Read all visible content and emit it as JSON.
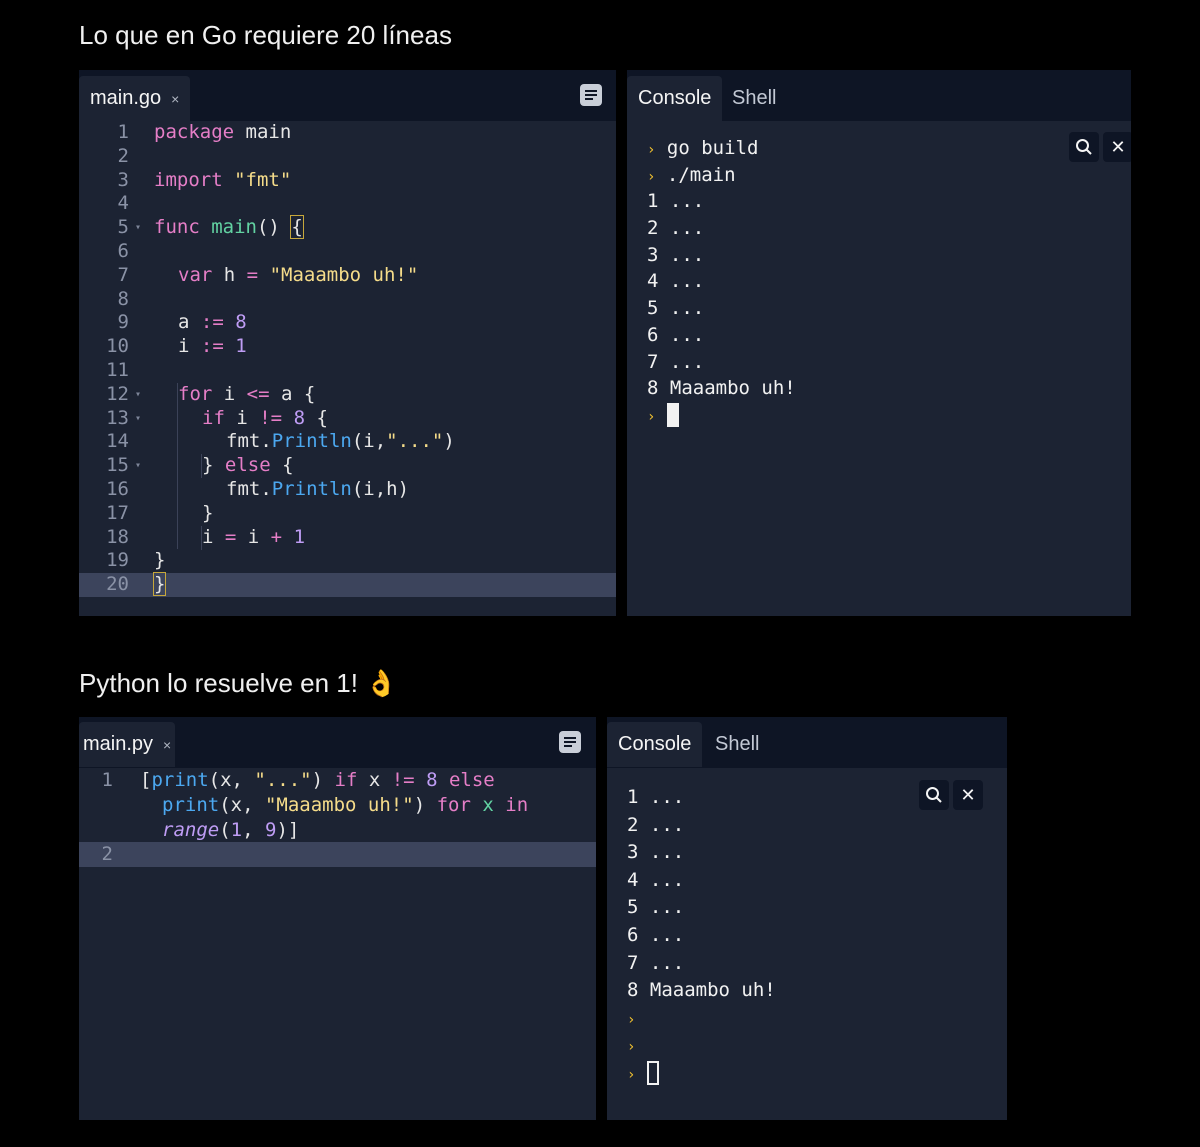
{
  "captions": {
    "go": "Lo que en Go requiere 20 líneas",
    "python": "Python lo resuelve en 1! 👌"
  },
  "go_panel": {
    "editor_tab": "main.go",
    "tab_close": "×",
    "console_tabs": [
      "Console",
      "Shell"
    ],
    "line_numbers": [
      "1",
      "2",
      "3",
      "4",
      "5",
      "6",
      "7",
      "8",
      "9",
      "10",
      "11",
      "12",
      "13",
      "14",
      "15",
      "16",
      "17",
      "18",
      "19",
      "20"
    ],
    "console_lines": [
      "go build",
      "./main",
      "1 ...",
      "2 ...",
      "3 ...",
      "4 ...",
      "5 ...",
      "6 ...",
      "7 ...",
      "8 Maaambo uh!"
    ],
    "prompt_symbol": "›",
    "tool_icons": [
      "search-icon",
      "close-icon"
    ]
  },
  "py_panel": {
    "editor_tab": "main.py",
    "tab_close": "×",
    "console_tabs": [
      "Console",
      "Shell"
    ],
    "line_numbers": [
      "1",
      "2"
    ],
    "console_lines": [
      "1 ...",
      "2 ...",
      "3 ...",
      "4 ...",
      "5 ...",
      "6 ...",
      "7 ...",
      "8 Maaambo uh!"
    ],
    "prompt_symbol": "›",
    "tool_icons": [
      "search-icon",
      "close-icon"
    ]
  },
  "colors": {
    "page_bg": "#000000",
    "editor_bg": "#1c2333",
    "tabbar_bg": "#0e1525",
    "keyword": "#e57ec7",
    "string": "#f5dc8a",
    "number": "#bf9df5",
    "function": "#62d2a2",
    "method": "#4ca8f0",
    "prompt": "#f2c230"
  }
}
